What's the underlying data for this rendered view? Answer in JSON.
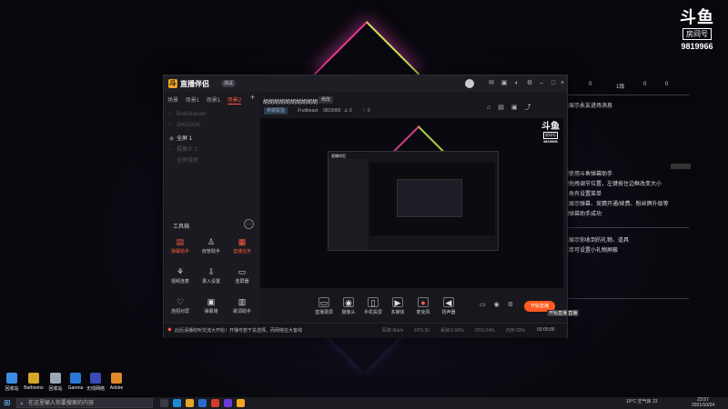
{
  "colors": {
    "accent": "#ff5a1f",
    "panel": "#1a1a20"
  },
  "brand": {
    "logo_text": "斗鱼",
    "badge": "房间号",
    "room_number": "9819966"
  },
  "overlay": {
    "stats": [
      "9",
      "0",
      "1级",
      "0",
      "0"
    ],
    "welcome": "这里展示永友进场消息",
    "help_lines": [
      "欢迎使用斗鱼弹幕助手",
      "左键拖拽调节位置，左键按住边框改变大小",
      "右上角有设置菜单",
      "这里展示弹幕、竞猜开通/续费、粉丝牌升级等",
      "添加弹幕助手成功"
    ],
    "gift_lines": [
      "这里展示你收到的礼物、道具",
      "点菜单可设置小礼物屏蔽"
    ]
  },
  "desktop_icons": [
    {
      "label": "回收站",
      "icon": "recycle-bin-icon",
      "color": "#3a8de0"
    },
    {
      "label": "Bathtomo",
      "icon": "app-icon",
      "color": "#d4a62a"
    },
    {
      "label": "回收站",
      "icon": "recycle-bin-icon",
      "color": "#9aa7b5"
    },
    {
      "label": "Garena",
      "icon": "app-icon",
      "color": "#2a7ad4"
    },
    {
      "label": "无线网络",
      "icon": "app-icon",
      "color": "#3c4ab8"
    },
    {
      "label": "Adobe",
      "icon": "app-icon",
      "color": "#e08a2a"
    }
  ],
  "taskbar": {
    "search_placeholder": "在这里输入你要搜索的内容",
    "tray_text": "19°C 空气良 23",
    "clock_time": "23:57",
    "clock_date": "2021/10/24"
  },
  "app": {
    "name": "直播伴侣",
    "version": "测试",
    "scene_tabs": [
      "场景",
      "场景1",
      "场景1",
      "场景2"
    ],
    "sources": [
      "BrailStander",
      "SHOOOK",
      "全屏 1",
      "摄像头 1",
      "全屏投射"
    ],
    "tools_title": "工具箱",
    "tools": [
      {
        "label": "弹幕助手",
        "icon": "barrage-icon",
        "red": true
      },
      {
        "label": "房管助手",
        "icon": "admin-icon",
        "red": false
      },
      {
        "label": "直播任务",
        "icon": "task-icon",
        "red": true
      },
      {
        "label": "视频连麦",
        "icon": "video-link-icon",
        "red": false
      },
      {
        "label": "录入设置",
        "icon": "download-icon",
        "red": false
      },
      {
        "label": "连屏器",
        "icon": "screen-icon",
        "red": false
      },
      {
        "label": "连招对屏",
        "icon": "combo-icon",
        "red": false
      },
      {
        "label": "弹幕墙",
        "icon": "wall-icon",
        "red": false
      },
      {
        "label": "歌词助手",
        "icon": "lyrics-icon",
        "red": false
      },
      {
        "label": "美颜",
        "icon": "beauty-icon",
        "red": false
      },
      {
        "label": "新",
        "icon": "new-icon",
        "red": false
      },
      {
        "label": "更多",
        "icon": "more-icon",
        "red": false
      }
    ],
    "room": {
      "title": "胡胡胡胡胡胡胡胡胡胡",
      "modify_label": "修改",
      "category": "英雄联盟",
      "user": "Fruitbeast",
      "room_id": "9819966",
      "viewers": "0",
      "fans": "0"
    },
    "bottom_tools": [
      {
        "label": "直播录屏",
        "icon": "record-icon"
      },
      {
        "label": "摄像头",
        "icon": "camera-icon"
      },
      {
        "label": "手机投屏",
        "icon": "phone-cast-icon"
      },
      {
        "label": "多媒体",
        "icon": "media-icon"
      },
      {
        "label": "麦克风",
        "icon": "mic-icon"
      },
      {
        "label": "扬声器",
        "icon": "speaker-icon"
      }
    ],
    "go_live_label": "开始直播",
    "go_live_tip": "开始直播 直播",
    "status_message": "此后请播收听交流大开始！开播可若干关选择，而网络在大客线",
    "status_stats": [
      "码率:0kb/s",
      "FPS:30",
      "丢帧:0.00%",
      "CPU:24%",
      "内存:20%"
    ],
    "status_time": "00:00:00"
  }
}
